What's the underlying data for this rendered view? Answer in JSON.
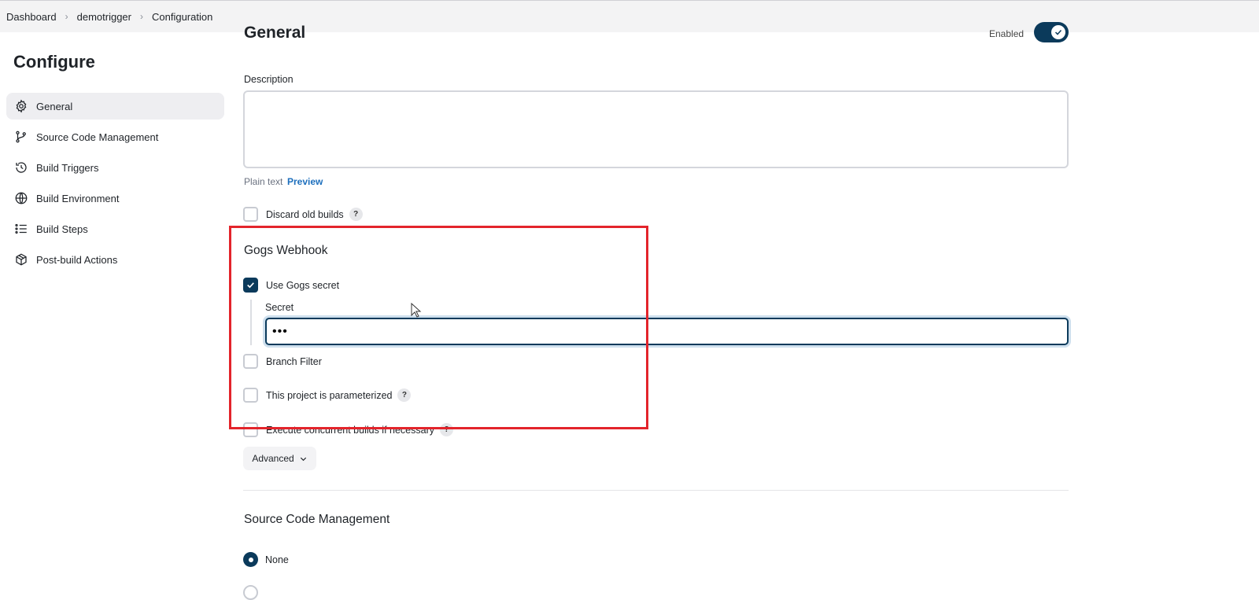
{
  "breadcrumb": {
    "items": [
      "Dashboard",
      "demotrigger",
      "Configuration"
    ]
  },
  "page_title": "Configure",
  "sidebar": {
    "items": [
      {
        "label": "General",
        "icon": "gear-icon",
        "active": true
      },
      {
        "label": "Source Code Management",
        "icon": "git-branch-icon"
      },
      {
        "label": "Build Triggers",
        "icon": "clock-icon"
      },
      {
        "label": "Build Environment",
        "icon": "globe-icon"
      },
      {
        "label": "Build Steps",
        "icon": "list-icon"
      },
      {
        "label": "Post-build Actions",
        "icon": "package-icon"
      }
    ]
  },
  "general": {
    "title": "General",
    "enabled_label": "Enabled",
    "description_label": "Description",
    "description_value": "",
    "plain_text": "Plain text",
    "preview_link": "Preview",
    "discard_old_builds": "Discard old builds",
    "help_glyph": "?"
  },
  "gogs": {
    "title": "Gogs Webhook",
    "use_secret_label": "Use Gogs secret",
    "secret_label": "Secret",
    "secret_value": "•••",
    "branch_filter_label": "Branch Filter",
    "parameterized_label": "This project is parameterized",
    "concurrent_label": "Execute concurrent builds if necessary"
  },
  "advanced_label": "Advanced",
  "scm": {
    "title": "Source Code Management",
    "none_label": "None"
  },
  "colors": {
    "accent": "#0b3a5b",
    "highlight": "#e3242b",
    "link": "#1d6fbd"
  }
}
